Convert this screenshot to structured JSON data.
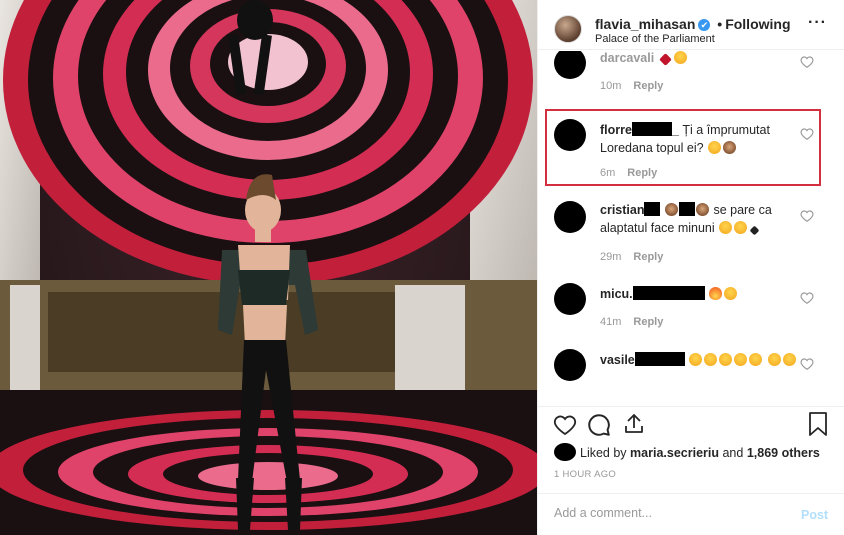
{
  "post": {
    "username": "flavia_mihasan",
    "verified_badge": "✔",
    "separator": "•",
    "follow_status": "Following",
    "location": "Palace of the Parliament",
    "more_icon": "more-dots-icon",
    "more_glyph": "···"
  },
  "comments": [
    {
      "username": "darcavali",
      "text": "",
      "emojis": [
        "heart-red",
        "smile"
      ],
      "time": "10m",
      "reply": "Reply"
    },
    {
      "username": "florre",
      "username_suffix": "_",
      "text": "Ți a împrumutat Loredana topul ei?",
      "emojis": [
        "laughing",
        "monkey"
      ],
      "time": "6m",
      "reply": "Reply",
      "highlighted": true
    },
    {
      "username": "cristian",
      "text": "se pare ca alaptatul face minuni",
      "emojis_inline": [
        "monkey",
        "monkey"
      ],
      "emojis": [
        "smile",
        "smile",
        "heart-black"
      ],
      "time": "29m",
      "reply": "Reply"
    },
    {
      "username": "micu.",
      "text": "",
      "emojis": [
        "fire",
        "heart-eyes"
      ],
      "time": "41m",
      "reply": "Reply"
    },
    {
      "username": "vasile",
      "text": "",
      "emojis": [
        "heart-eyes",
        "heart-eyes",
        "heart-eyes",
        "heart-eyes",
        "heart-eyes",
        "heart-eyes",
        "heart-eyes"
      ],
      "time": "",
      "reply": ""
    }
  ],
  "actions": {
    "like_icon": "heart-outline-icon",
    "comment_icon": "comment-bubble-icon",
    "share_icon": "share-icon",
    "save_icon": "bookmark-icon"
  },
  "likes": {
    "prefix": "Liked by",
    "user": "maria.secrieriu",
    "middle": "and",
    "count": "1,869 others"
  },
  "timestamp": "1 HOUR AGO",
  "add_comment": {
    "placeholder": "Add a comment...",
    "post_label": "Post"
  },
  "colors": {
    "accent": "#3897f0",
    "highlight": "#d32f3f",
    "post_disabled": "#b2dffc"
  }
}
